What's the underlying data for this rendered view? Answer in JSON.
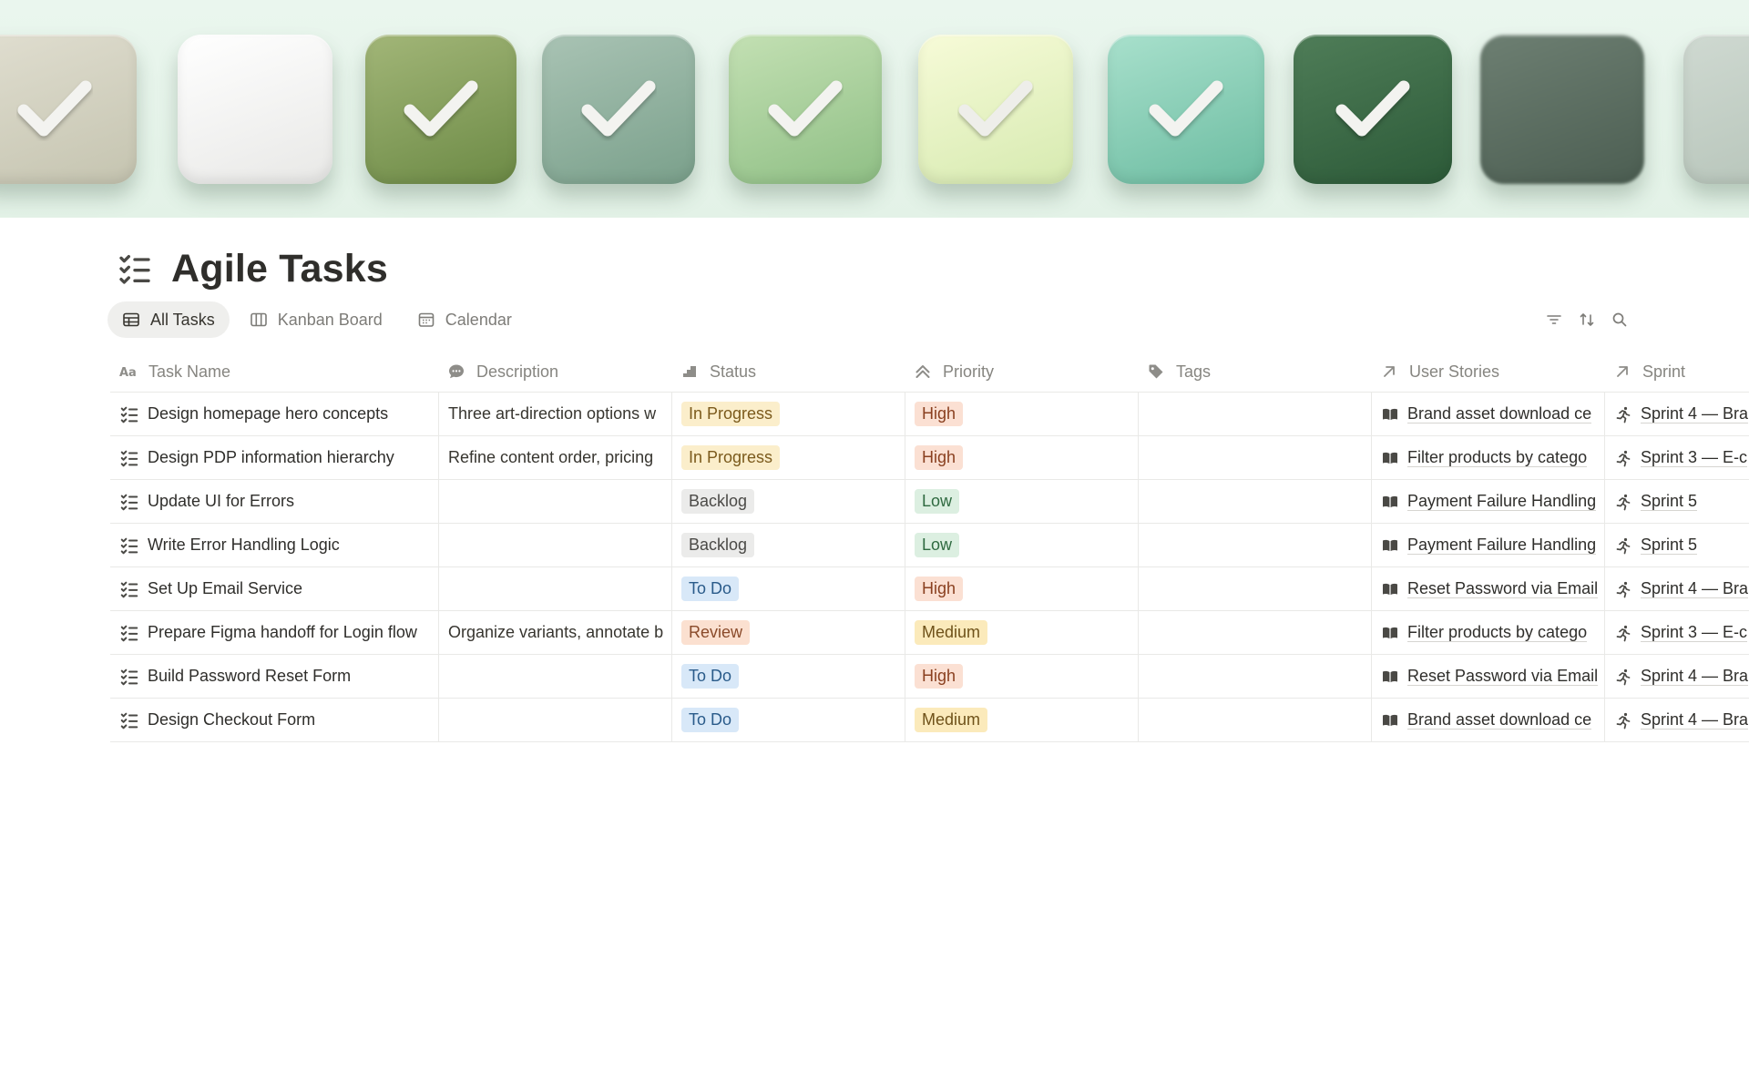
{
  "page": {
    "title": "Agile Tasks",
    "title_icon": "checklist-icon"
  },
  "cover": {
    "tiles": [
      {
        "color_top": "#e0ded0",
        "color_bottom": "#c5c4b0",
        "check": "#f3f3f0"
      },
      {
        "color_top": "#ffffff",
        "color_bottom": "#e8e8e6",
        "check": "none"
      },
      {
        "color_top": "#a2b678",
        "color_bottom": "#6c8a45",
        "check": "#f3f3f0"
      },
      {
        "color_top": "#a9c3b4",
        "color_bottom": "#7aa08b",
        "check": "#f3f3f0"
      },
      {
        "color_top": "#c3e0b3",
        "color_bottom": "#8fbf85",
        "check": "#f3f3f0"
      },
      {
        "color_top": "#f7fbd8",
        "color_bottom": "#d6eab0",
        "check": "#eeeeea"
      },
      {
        "color_top": "#a8e0cc",
        "color_bottom": "#6cbca1",
        "check": "#f3f3f0"
      },
      {
        "color_top": "#4f7d58",
        "color_bottom": "#2c5a38",
        "check": "#f3f3f0"
      },
      {
        "color_top": "#6d7f72",
        "color_bottom": "#4c5e52",
        "check": "none"
      },
      {
        "color_top": "#cfd9d1",
        "color_bottom": "#b5c3b8",
        "check": "none"
      }
    ]
  },
  "tabs": [
    {
      "label": "All Tasks",
      "icon": "table-icon",
      "active": true
    },
    {
      "label": "Kanban Board",
      "icon": "board-icon",
      "active": false
    },
    {
      "label": "Calendar",
      "icon": "calendar-icon",
      "active": false
    }
  ],
  "toolbar": [
    "filter-icon",
    "sort-icon",
    "search-icon"
  ],
  "columns": [
    {
      "label": "Task Name",
      "icon": "text-property-icon"
    },
    {
      "label": "Description",
      "icon": "speech-bubble-icon"
    },
    {
      "label": "Status",
      "icon": "status-icon"
    },
    {
      "label": "Priority",
      "icon": "double-chevron-up-icon"
    },
    {
      "label": "Tags",
      "icon": "tag-icon"
    },
    {
      "label": "User Stories",
      "icon": "relation-arrow-icon"
    },
    {
      "label": "Sprint",
      "icon": "relation-arrow-icon"
    }
  ],
  "tag_colors": {
    "In Progress": {
      "bg": "#fbeecb",
      "fg": "#7b5a1c"
    },
    "Backlog": {
      "bg": "#ebebea",
      "fg": "#4b4a47"
    },
    "To Do": {
      "bg": "#d8e8f8",
      "fg": "#2a5b8a"
    },
    "Review": {
      "bg": "#fbe0d0",
      "fg": "#8a4a2a"
    },
    "High": {
      "bg": "#fbe0d3",
      "fg": "#8a4020"
    },
    "Low": {
      "bg": "#dcefe1",
      "fg": "#2f6a40"
    },
    "Medium": {
      "bg": "#fbeabb",
      "fg": "#6f521a"
    }
  },
  "rows": [
    {
      "name": "Design homepage hero concepts",
      "description": "Three art-direction options w",
      "status": "In Progress",
      "priority": "High",
      "tags": "",
      "user_story": "Brand asset download ce",
      "sprint": "Sprint 4 — Bra"
    },
    {
      "name": "Design PDP information hierarchy",
      "description": "Refine content order, pricing",
      "status": "In Progress",
      "priority": "High",
      "tags": "",
      "user_story": "Filter products by catego",
      "sprint": "Sprint 3 — E-c"
    },
    {
      "name": "Update UI for Errors",
      "description": "",
      "status": "Backlog",
      "priority": "Low",
      "tags": "",
      "user_story": "Payment Failure Handling",
      "sprint": "Sprint 5"
    },
    {
      "name": "Write Error Handling Logic",
      "description": "",
      "status": "Backlog",
      "priority": "Low",
      "tags": "",
      "user_story": "Payment Failure Handling",
      "sprint": "Sprint 5"
    },
    {
      "name": "Set Up Email Service",
      "description": "",
      "status": "To Do",
      "priority": "High",
      "tags": "",
      "user_story": "Reset Password via Email",
      "sprint": "Sprint 4 — Bra"
    },
    {
      "name": "Prepare Figma handoff for Login flow",
      "description": "Organize variants, annotate b",
      "status": "Review",
      "priority": "Medium",
      "tags": "",
      "user_story": "Filter products by catego",
      "sprint": "Sprint 3 — E-c"
    },
    {
      "name": "Build Password Reset Form",
      "description": "",
      "status": "To Do",
      "priority": "High",
      "tags": "",
      "user_story": "Reset Password via Email",
      "sprint": "Sprint 4 — Bra"
    },
    {
      "name": "Design Checkout Form",
      "description": "",
      "status": "To Do",
      "priority": "Medium",
      "tags": "",
      "user_story": "Brand asset download ce",
      "sprint": "Sprint 4 — Bra"
    }
  ]
}
